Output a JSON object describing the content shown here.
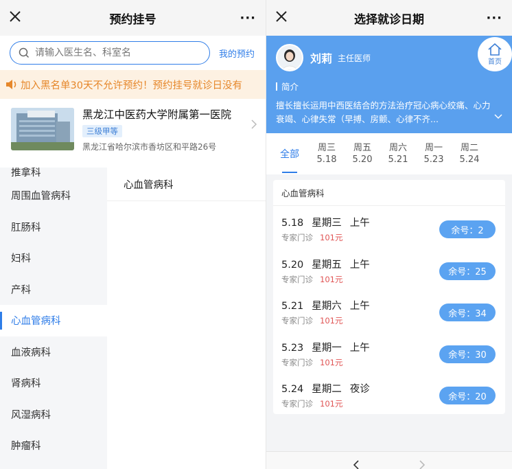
{
  "left": {
    "title": "预约挂号",
    "more": "···",
    "search": {
      "placeholder": "请输入医生名、科室名",
      "my_appointments": "我的预约"
    },
    "notice": "加入黑名单30天不允许预约！预约挂号就诊日没有",
    "hospital": {
      "name": "黑龙江中医药大学附属第一医院",
      "level": "三级甲等",
      "address": "黑龙江省哈尔滨市香坊区和平路26号"
    },
    "departments": [
      "推拿科",
      "周围血管病科",
      "肛肠科",
      "妇科",
      "产科",
      "心血管病科",
      "血液病科",
      "肾病科",
      "风湿病科",
      "肿瘤科"
    ],
    "active_department": "心血管病科",
    "sub_departments": [
      "心血管病科"
    ]
  },
  "right": {
    "title": "选择就诊日期",
    "more": "···",
    "doctor": {
      "name": "刘莉",
      "title": "主任医师",
      "intro_label": "简介",
      "intro": "擅长擅长运用中西医结合的方法治疗冠心病心绞痛、心力衰竭、心律失常（早搏、房颤、心律不齐..."
    },
    "home_label": "首页",
    "tabs": {
      "all": "全部",
      "days": [
        {
          "weekday": "周三",
          "date": "5.18"
        },
        {
          "weekday": "周五",
          "date": "5.20"
        },
        {
          "weekday": "周六",
          "date": "5.21"
        },
        {
          "weekday": "周一",
          "date": "5.23"
        },
        {
          "weekday": "周二",
          "date": "5.24"
        }
      ]
    },
    "schedule": {
      "department": "心血管病科",
      "slots": [
        {
          "date": "5.18",
          "weekday": "星期三",
          "period": "上午",
          "type": "专家门诊",
          "price": "101元",
          "remaining": "余号：2"
        },
        {
          "date": "5.20",
          "weekday": "星期五",
          "period": "上午",
          "type": "专家门诊",
          "price": "101元",
          "remaining": "余号：25"
        },
        {
          "date": "5.21",
          "weekday": "星期六",
          "period": "上午",
          "type": "专家门诊",
          "price": "101元",
          "remaining": "余号：34"
        },
        {
          "date": "5.23",
          "weekday": "星期一",
          "period": "上午",
          "type": "专家门诊",
          "price": "101元",
          "remaining": "余号：30"
        },
        {
          "date": "5.24",
          "weekday": "星期二",
          "period": "夜诊",
          "type": "专家门诊",
          "price": "101元",
          "remaining": "余号：20"
        }
      ]
    }
  },
  "colors": {
    "accent": "#2f7de8",
    "header_blue": "#5aa0ee",
    "notice_orange": "#e6872a",
    "price_red": "#e05454"
  }
}
